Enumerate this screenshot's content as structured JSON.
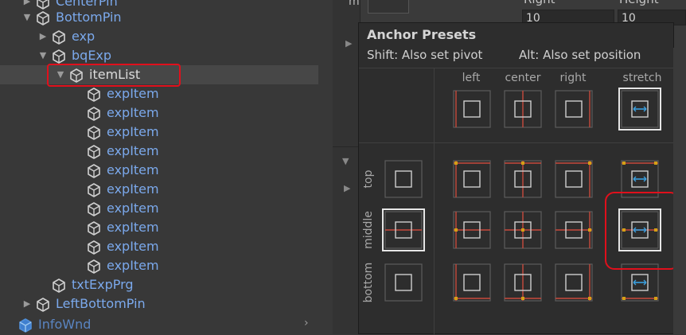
{
  "hierarchy": {
    "rows": [
      {
        "label": "CenterPin",
        "color": "blue",
        "arrow": "▶"
      },
      {
        "label": "BottomPin",
        "color": "blue",
        "arrow": "▼"
      },
      {
        "label": "exp",
        "color": "blue",
        "arrow": "▶"
      },
      {
        "label": "bqExp",
        "color": "blue",
        "arrow": "▼"
      },
      {
        "label": "itemList",
        "color": "white",
        "arrow": "▼"
      },
      {
        "label": "expItem",
        "color": "blue",
        "arrow": ""
      },
      {
        "label": "expItem",
        "color": "blue",
        "arrow": ""
      },
      {
        "label": "expItem",
        "color": "blue",
        "arrow": ""
      },
      {
        "label": "expItem",
        "color": "blue",
        "arrow": ""
      },
      {
        "label": "expItem",
        "color": "blue",
        "arrow": ""
      },
      {
        "label": "expItem",
        "color": "blue",
        "arrow": ""
      },
      {
        "label": "expItem",
        "color": "blue",
        "arrow": ""
      },
      {
        "label": "expItem",
        "color": "blue",
        "arrow": ""
      },
      {
        "label": "expItem",
        "color": "blue",
        "arrow": ""
      },
      {
        "label": "expItem",
        "color": "blue",
        "arrow": ""
      },
      {
        "label": "txtExpPrg",
        "color": "blue",
        "arrow": ""
      },
      {
        "label": "LeftBottomPin",
        "color": "blue",
        "arrow": "▶"
      },
      {
        "label": "InfoWnd",
        "color": "dim",
        "arrow": ""
      }
    ],
    "selected_label": "itemList"
  },
  "inspector": {
    "right_header": "Right",
    "height_header": "Height",
    "right_value": "10",
    "height_value": "10",
    "strip_label": "m"
  },
  "anchor_presets": {
    "title": "Anchor Presets",
    "shift_hint": "Shift: Also set pivot",
    "alt_hint": "Alt: Also set position",
    "columns": [
      "left",
      "center",
      "right",
      "stretch"
    ],
    "rows": [
      "top",
      "middle",
      "bottom"
    ],
    "selected": "middle-stretch"
  },
  "colors": {
    "accent_red": "#e0101c",
    "anchor_red": "#c84a3c",
    "anchor_blue": "#3aa0e0",
    "anchor_dot": "#d4a016",
    "hier_blue": "#7ba9ec"
  }
}
